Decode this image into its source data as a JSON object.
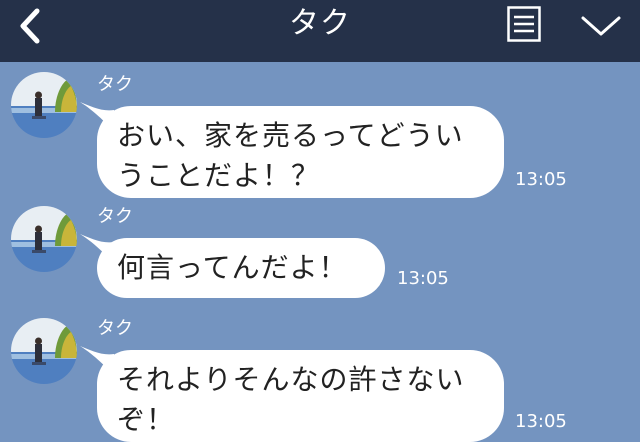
{
  "header": {
    "title": "タク",
    "back_icon": "chevron-left-icon",
    "menu_icon": "menu-icon",
    "collapse_icon": "chevron-down-icon",
    "background": "#253149"
  },
  "chat": {
    "background": "#7494c0",
    "messages": [
      {
        "sender": "タク",
        "lines": [
          "おい、家を売るってどうい",
          "うことだよ！？"
        ],
        "time": "13:05"
      },
      {
        "sender": "タク",
        "lines": [
          "何言ってんだよ！"
        ],
        "time": "13:05"
      },
      {
        "sender": "タク",
        "lines": [
          "それよりそんなの許さない",
          "ぞ！"
        ],
        "time": "13:05"
      }
    ]
  }
}
